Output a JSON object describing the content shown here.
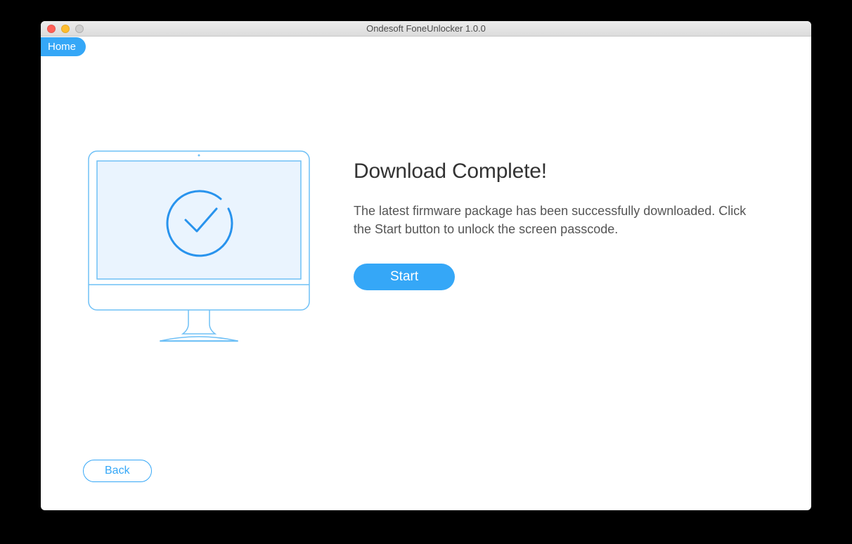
{
  "window": {
    "title": "Ondesoft FoneUnlocker 1.0.0"
  },
  "nav": {
    "home_label": "Home"
  },
  "main": {
    "heading": "Download Complete!",
    "description": "The latest firmware package has been successfully downloaded. Click the Start button to unlock the screen passcode.",
    "start_label": "Start"
  },
  "footer": {
    "back_label": "Back"
  },
  "icons": {
    "illustration": "imac-checkmark-icon"
  },
  "colors": {
    "accent": "#35a7f7",
    "imac_stroke": "#6fc0f6",
    "screen_fill": "#eaf4fe"
  }
}
